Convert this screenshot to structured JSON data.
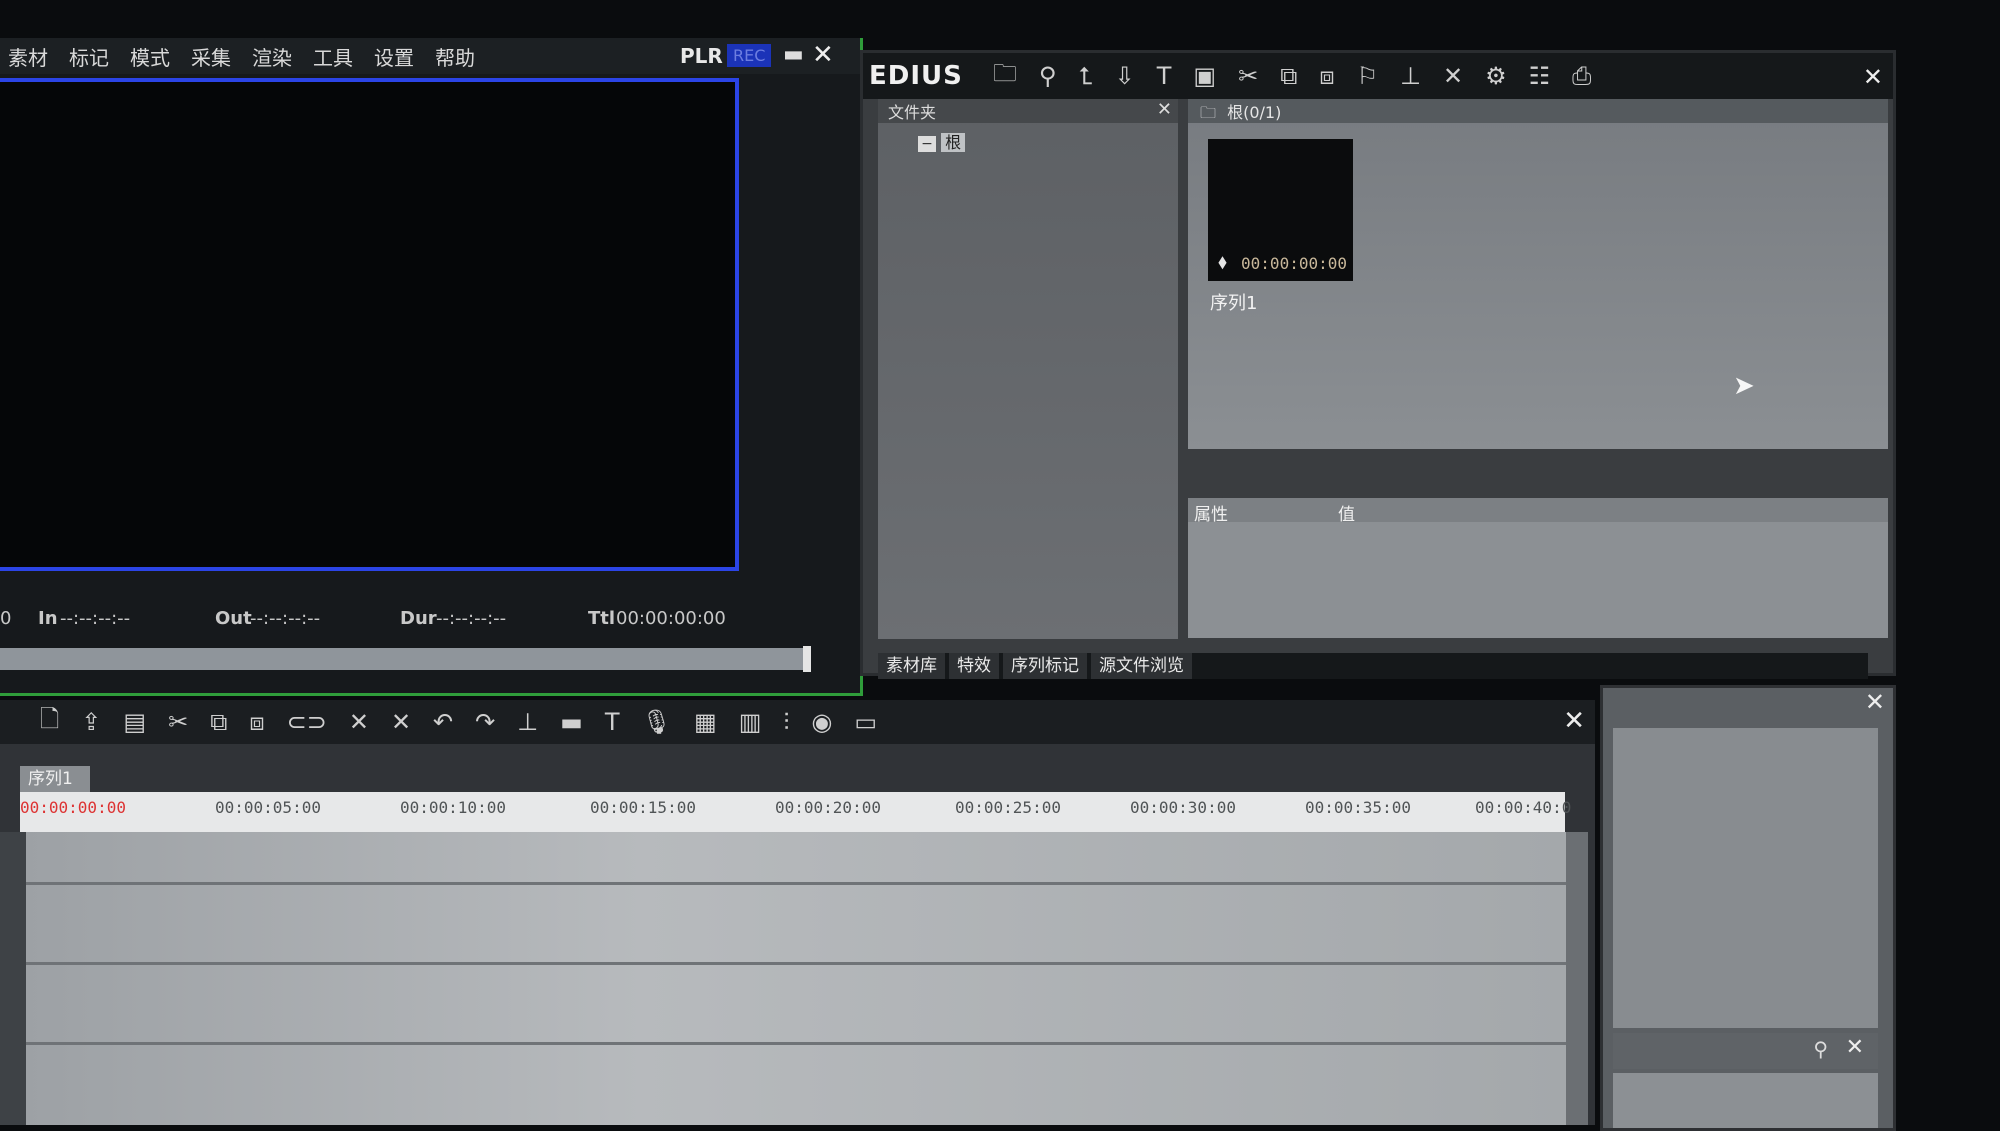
{
  "player": {
    "menu": [
      "素材",
      "标记",
      "模式",
      "采集",
      "渲染",
      "工具",
      "设置",
      "帮助"
    ],
    "plr_label": "PLR",
    "rec_label": "REC",
    "timecodes": {
      "leading": "0",
      "in_label": "In",
      "in_value": "--:--:--:--",
      "out_label": "Out",
      "out_value": "--:--:--:--",
      "dur_label": "Dur",
      "dur_value": "--:--:--:--",
      "ttl_label": "Ttl",
      "ttl_value": "00:00:00:00"
    }
  },
  "library": {
    "logo": "EDIUS",
    "folder_title": "文件夹",
    "folder_root": "根",
    "clip_header": "根(0/1)",
    "clip_timecode": "00:00:00:00",
    "clip_label": "序列1",
    "prop_attr": "属性",
    "prop_value": "值",
    "tabs": [
      "素材库",
      "特效",
      "序列标记",
      "源文件浏览"
    ]
  },
  "timeline": {
    "sequence_tab": "序列1",
    "ruler": [
      "00:00:00:00",
      "00:00:05:00",
      "00:00:10:00",
      "00:00:15:00",
      "00:00:20:00",
      "00:00:25:00",
      "00:00:30:00",
      "00:00:35:00",
      "00:00:40:0"
    ]
  },
  "icons": {
    "close": "✕",
    "minimize": "▬",
    "cursor": "➤"
  }
}
